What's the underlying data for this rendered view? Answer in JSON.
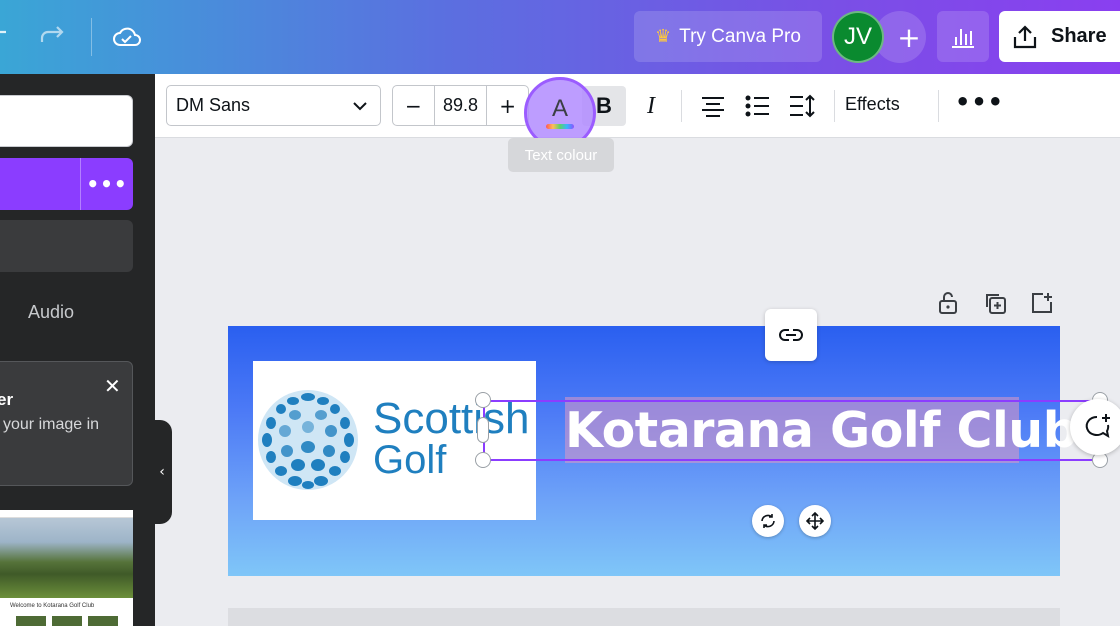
{
  "topbar": {
    "undo_icon": "undo-icon",
    "redo_icon": "redo-icon",
    "cloud_icon": "cloud-check-icon",
    "try_pro_label": "Try Canva Pro",
    "crown_icon": "crown-icon",
    "avatar_initials": "JV",
    "add_collaborator_label": "+",
    "share_label": "Share"
  },
  "left_panel": {
    "more_label": "•••",
    "audio_label": "Audio",
    "card_title": "er",
    "card_text": "your image in",
    "card_close": "✕",
    "thumb_caption": "Welcome to Kotarana Golf Club",
    "collapse_glyph": "‹"
  },
  "format_toolbar": {
    "font_name": "DM Sans",
    "decrease_label": "−",
    "font_size": "89.8",
    "increase_label": "+",
    "text_colour_glyph": "A",
    "bold_label": "B",
    "italic_label": "I",
    "effects_label": "Effects",
    "more_label": "•••",
    "tooltip": "Text colour"
  },
  "design": {
    "logo_line1": "Scottish",
    "logo_line2": "Golf",
    "title": "Kotarana Golf Club"
  },
  "colors": {
    "accent": "#8b3dff",
    "avatar_bg": "#0a8a2f",
    "logo_blue": "#1f7fbf",
    "panel_bg": "#252627"
  }
}
